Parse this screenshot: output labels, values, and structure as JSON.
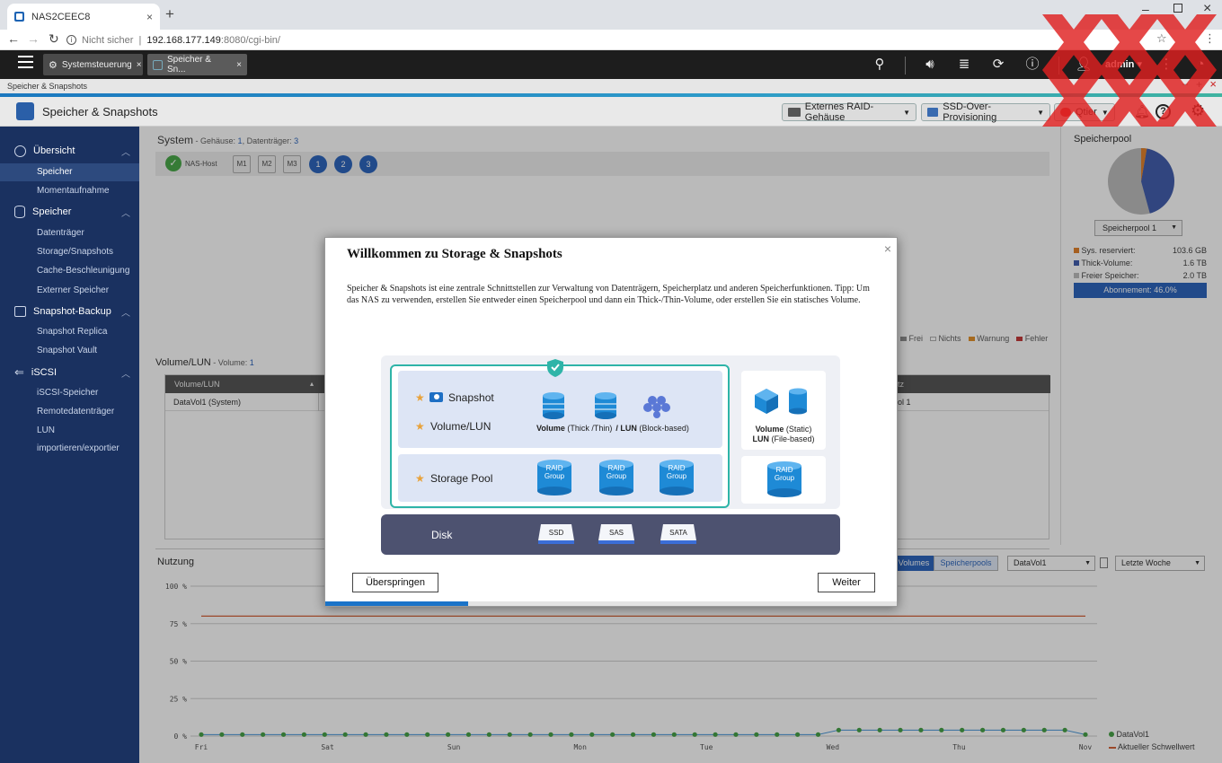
{
  "browser": {
    "tab_title": "NAS2CEEC8",
    "new_tab_symbol": "+",
    "security_label": "Nicht sicher",
    "url_host": "192.168.177.149",
    "url_path": ":8080/cgi-bin/"
  },
  "qts_topbar": {
    "app_tabs": [
      {
        "label": "Systemsteuerung"
      },
      {
        "label": "Speicher & Sn..."
      }
    ],
    "user": "admin"
  },
  "app": {
    "window_strip_title": "Speicher & Snapshots",
    "title": "Speicher & Snapshots",
    "header_buttons": {
      "raid": "Externes RAID-Gehäuse",
      "ssd": "SSD-Over-Provisioning",
      "qtier": "Qtier"
    }
  },
  "sidebar": {
    "sections": [
      {
        "label": "Übersicht",
        "items": [
          "Speicher",
          "Momentaufnahme"
        ]
      },
      {
        "label": "Speicher",
        "items": [
          "Datenträger",
          "Storage/Snapshots",
          "Cache-Beschleunigung",
          "Externer Speicher"
        ]
      },
      {
        "label": "Snapshot-Backup",
        "items": [
          "Snapshot Replica",
          "Snapshot Vault"
        ]
      },
      {
        "label": "iSCSI",
        "items": [
          "iSCSI-Speicher",
          "Remotedatenträger",
          "LUN importieren/exportier"
        ]
      }
    ]
  },
  "system": {
    "title": "System",
    "subtitle_prefix": " - Gehäuse: ",
    "enclosures": "1",
    "disks_prefix": ", Datenträger: ",
    "disks": "3",
    "host_label": "NAS-Host",
    "slots": [
      "M1",
      "M2",
      "M3"
    ],
    "drives": [
      "1",
      "2",
      "3"
    ]
  },
  "legend_status": [
    "Frei",
    "Nichts",
    "Warnung",
    "Fehler"
  ],
  "volume_section": {
    "title": "Volume/LUN",
    "count_prefix": " - Volume: ",
    "count": "1",
    "col_header": "Volume/LUN",
    "col_header_right": "tz",
    "row_name": "DataVol1 (System)",
    "row_right": "ol 1"
  },
  "storage_pool_panel": {
    "title": "Speicherpool",
    "select": "Speicherpool 1",
    "legend": [
      {
        "label": "Sys. reserviert:",
        "value": "103.6 GB",
        "color": "#e07a1c"
      },
      {
        "label": "Thick-Volume:",
        "value": "1.6 TB",
        "color": "#3553a8"
      },
      {
        "label": "Freier Speicher:",
        "value": "2.0 TB",
        "color": "#b8b8b8"
      }
    ],
    "subscription": "Abonnement: 46.0%"
  },
  "usage": {
    "title": "Nutzung",
    "toggle_volumes": "Volumes",
    "toggle_pools": "Speicherpools",
    "volume_select": "DataVol1",
    "range_select": "Letzte Woche",
    "legend": [
      "DataVol1",
      "Aktueller Schwellwert"
    ]
  },
  "chart_data": {
    "type": "line",
    "x": [
      "Fri",
      "Sat",
      "Sun",
      "Mon",
      "Tue",
      "Wed",
      "Thu",
      "Nov"
    ],
    "ylim": [
      0,
      100
    ],
    "yticks": [
      "0 %",
      "25 %",
      "50 %",
      "75 %",
      "100 %"
    ],
    "series": [
      {
        "name": "DataVol1",
        "color": "#3a9b3a",
        "values": [
          1,
          1,
          1,
          1,
          1,
          1,
          1,
          1,
          1,
          1,
          1,
          1,
          1,
          1,
          1,
          1,
          1,
          1,
          1,
          1,
          1,
          1,
          1,
          1,
          1,
          1,
          1,
          1,
          1,
          1,
          1,
          4,
          4,
          4,
          4,
          4,
          4,
          4,
          4,
          4,
          4,
          4,
          4,
          1
        ]
      },
      {
        "name": "Aktueller Schwellwert",
        "color": "#d2572a",
        "values": [
          80,
          80
        ]
      }
    ]
  },
  "dialog": {
    "title": "Willkommen zu Storage & Snapshots",
    "close_symbol": "×",
    "description": "Speicher & Snapshots ist eine zentrale Schnittstellen zur Verwaltung von Datenträgern, Speicherplatz und anderen Speicherfunktionen. Tipp: Um das NAS zu verwenden, erstellen Sie entweder einen Speicherpool und dann ein Thick-/Thin-Volume, oder erstellen Sie ein statisches Volume.",
    "diagram": {
      "snapshot": "Snapshot",
      "volume_lun": "Volume/LUN",
      "volume_bold": "Volume",
      "volume_thin": " (Thick /Thin)",
      "lun_bold": "/ LUN",
      "lun_thin": " (Block-based)",
      "storage_pool": "Storage Pool",
      "raid_line1": "RAID",
      "raid_line2": "Group",
      "disk": "Disk",
      "disk_types": [
        "SSD",
        "SAS",
        "SATA"
      ],
      "static_volume_bold": "Volume",
      "static_volume_thin": " (Static)",
      "file_lun_bold": "LUN",
      "file_lun_thin": " (File-based)"
    },
    "skip_button": "Überspringen",
    "next_button": "Weiter",
    "progress": 0.25
  }
}
